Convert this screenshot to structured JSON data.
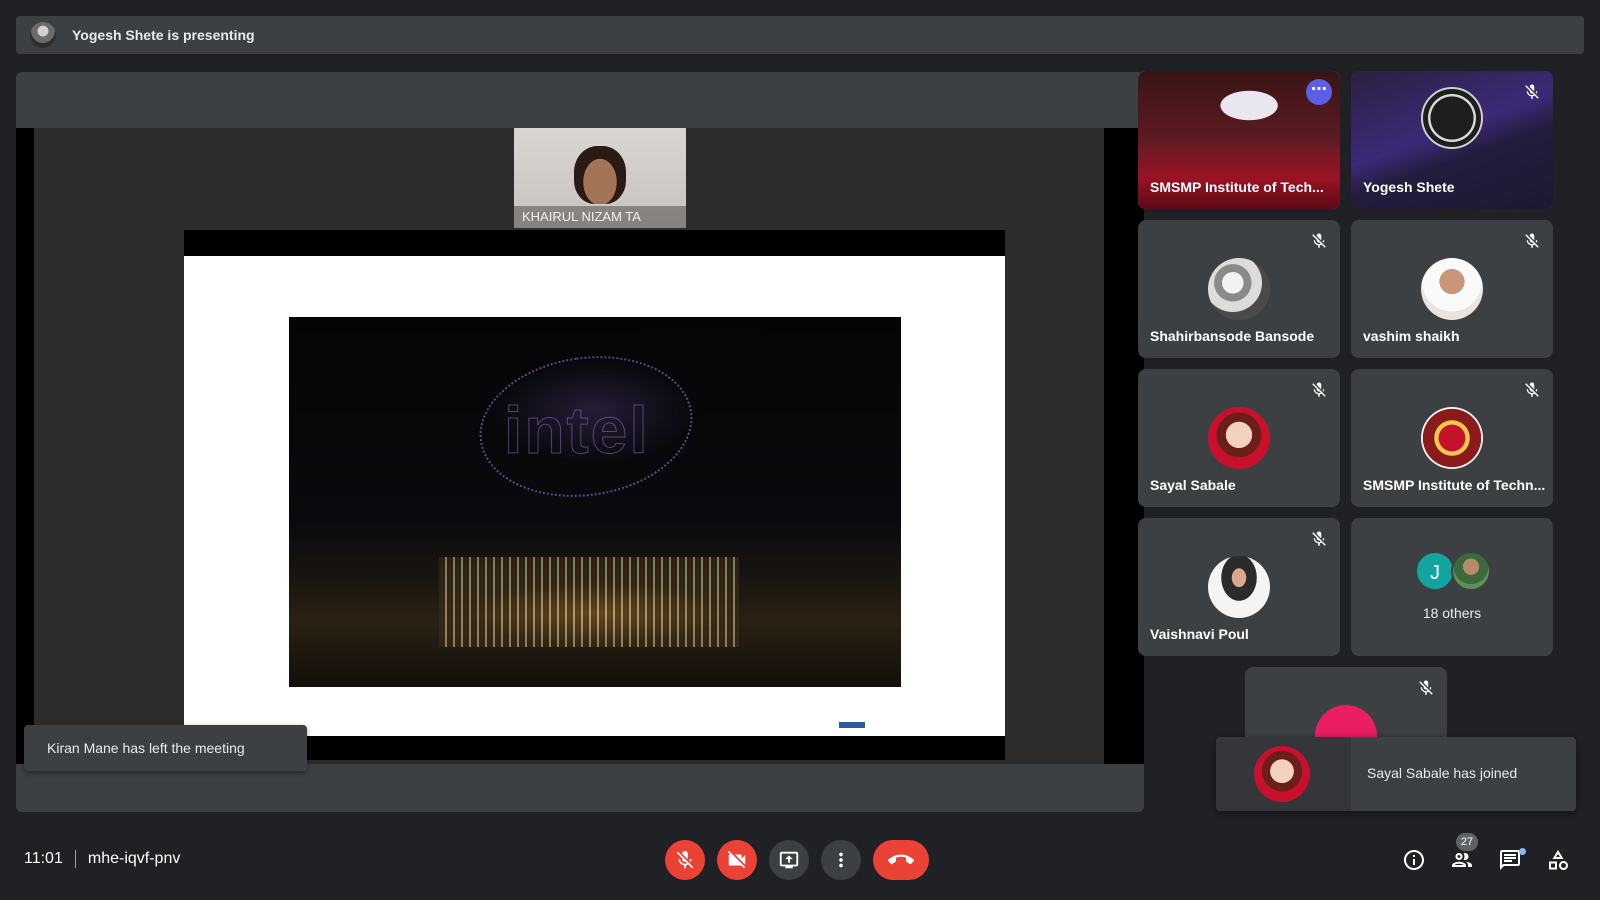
{
  "presenting": {
    "text": "Yogesh Shete is presenting"
  },
  "stage": {
    "camera_name": "KHAIRUL NIZAM TA",
    "slide_word": "intel"
  },
  "toast_left": {
    "text": "Kiran Mane has left the meeting"
  },
  "tiles": [
    {
      "name": "SMSMP Institute of Tech...",
      "muted": false,
      "selected": true
    },
    {
      "name": "Yogesh Shete",
      "muted": true
    },
    {
      "name": "Shahirbansode Bansode",
      "muted": true
    },
    {
      "name": "vashim shaikh",
      "muted": true
    },
    {
      "name": "Sayal Sabale",
      "muted": true
    },
    {
      "name": "SMSMP Institute of Techn...",
      "muted": true
    },
    {
      "name": "Vaishnavi Poul",
      "muted": true
    },
    {
      "others_label": "18 others",
      "initial": "J"
    },
    {
      "name": "",
      "muted": true
    }
  ],
  "join_toast": {
    "text": "Sayal Sabale has joined"
  },
  "bottom": {
    "time": "11:01",
    "meeting_code": "mhe-iqvf-pnv",
    "participant_count": "27"
  },
  "colors": {
    "background": "#202124",
    "surface": "#3c4043",
    "danger": "#ea4335",
    "accent": "#8ab4f8",
    "more": "#5b5ee6"
  },
  "icons": [
    "mic-off-icon",
    "camera-off-icon",
    "present-screen-icon",
    "more-vert-icon",
    "end-call-icon",
    "info-icon",
    "people-icon",
    "chat-icon",
    "activities-icon"
  ]
}
